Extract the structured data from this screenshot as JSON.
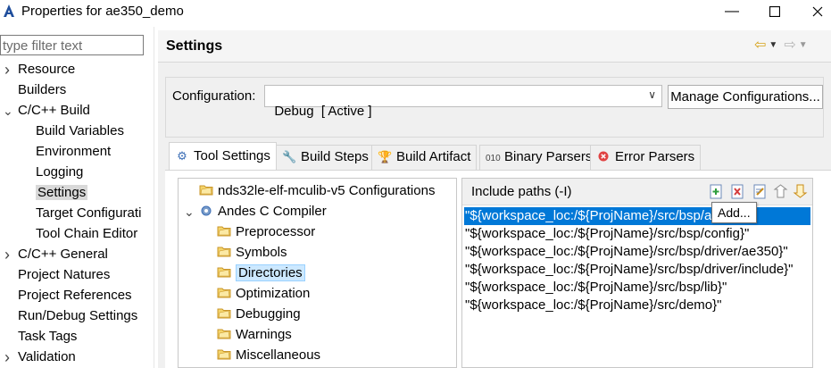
{
  "window": {
    "title": "Properties for ae350_demo",
    "minimize_glyph": "—",
    "maximize_glyph": "☐",
    "app_icon": "andes-logo-icon"
  },
  "left_panel": {
    "filter_placeholder": "type filter text",
    "items": [
      {
        "label": "Resource",
        "expander": ">"
      },
      {
        "label": "Builders"
      },
      {
        "label": "C/C++ Build",
        "expander": "v"
      },
      {
        "label": "Build Variables"
      },
      {
        "label": "Environment"
      },
      {
        "label": "Logging"
      },
      {
        "label": "Settings",
        "selected": true
      },
      {
        "label": "Target Configurati"
      },
      {
        "label": "Tool Chain Editor"
      },
      {
        "label": "C/C++ General",
        "expander": ">"
      },
      {
        "label": "Project Natures"
      },
      {
        "label": "Project References"
      },
      {
        "label": "Run/Debug Settings"
      },
      {
        "label": "Task Tags"
      },
      {
        "label": "Validation",
        "expander": ">"
      }
    ]
  },
  "settings": {
    "title": "Settings",
    "configuration_label": "Configuration:",
    "configuration_value": "Debug  [ Active ]",
    "manage_button": "Manage Configurations..."
  },
  "tabs": [
    {
      "label": "Tool Settings",
      "icon": "tool-settings-icon",
      "active": true
    },
    {
      "label": "Build Steps",
      "icon": "build-steps-icon"
    },
    {
      "label": "Build Artifact",
      "icon": "trophy-icon"
    },
    {
      "label": "Binary Parsers",
      "icon": "binary-icon"
    },
    {
      "label": "Error Parsers",
      "icon": "error-icon"
    }
  ],
  "tool_tree": [
    {
      "label": "nds32le-elf-mculib-v5 Configurations",
      "level": 0
    },
    {
      "label": "Andes C Compiler",
      "level": 0,
      "expander": "v"
    },
    {
      "label": "Preprocessor",
      "level": 1
    },
    {
      "label": "Symbols",
      "level": 1
    },
    {
      "label": "Directories",
      "level": 1,
      "selected": true
    },
    {
      "label": "Optimization",
      "level": 1
    },
    {
      "label": "Debugging",
      "level": 1
    },
    {
      "label": "Warnings",
      "level": 1
    },
    {
      "label": "Miscellaneous",
      "level": 1
    }
  ],
  "include_paths": {
    "title": "Include paths (-I)",
    "tooltip": "Add...",
    "tool_icons": [
      "add-icon",
      "delete-icon",
      "edit-icon",
      "move-up-icon",
      "move-down-icon"
    ],
    "rows": [
      "\"${workspace_loc:/${ProjName}/src/bsp/ae350}\"",
      "\"${workspace_loc:/${ProjName}/src/bsp/config}\"",
      "\"${workspace_loc:/${ProjName}/src/bsp/driver/ae350}\"",
      "\"${workspace_loc:/${ProjName}/src/bsp/driver/include}\"",
      "\"${workspace_loc:/${ProjName}/src/bsp/lib}\"",
      "\"${workspace_loc:/${ProjName}/src/demo}\""
    ]
  }
}
